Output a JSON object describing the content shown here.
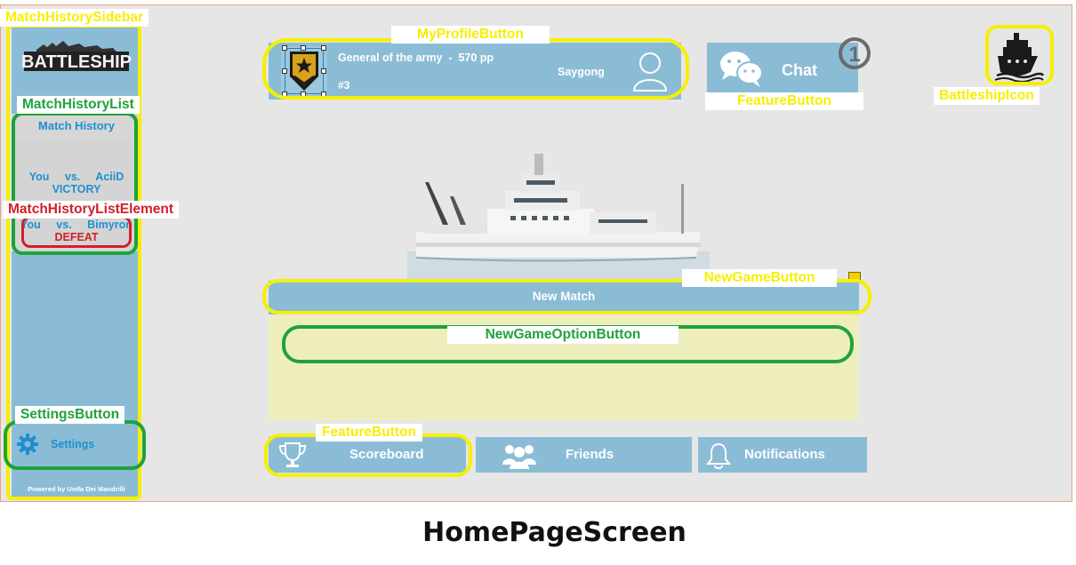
{
  "caption": "HomePageScreen",
  "sidebar": {
    "logo_text": "BATTLESHIP",
    "match_history_title": "Match History",
    "matches": [
      {
        "vs_text": "You vs. AciiD",
        "result": "VICTORY",
        "outcome": "victory"
      },
      {
        "vs_text": "You vs. Bimyron",
        "result": "DEFEAT",
        "outcome": "defeat"
      }
    ],
    "settings_label": "Settings",
    "powered_by": "Powered by Unifa Dei Mandrilli"
  },
  "profile": {
    "rank_line": "General of the army  -  570 pp",
    "rank_number": "#3",
    "username": "Saygong"
  },
  "chat": {
    "label": "Chat",
    "badge_count": "1"
  },
  "new_match_label": "New Match",
  "bottom_buttons": {
    "scoreboard": "Scoreboard",
    "friends": "Friends",
    "notifications": "Notifications"
  },
  "annotations": {
    "match_history_sidebar": "MatchHistorySidebar",
    "match_history_list": "MatchHistoryList",
    "match_history_list_element": "MatchHistoryListElement",
    "settings_button": "SettingsButton",
    "my_profile_button": "MyProfileButton",
    "feature_button_chat": "FeatureButton",
    "battleship_icon": "BattleshipIcon",
    "new_game_button": "NewGameButton",
    "new_game_option_button": "NewGameOptionButton",
    "feature_button_scoreboard": "FeatureButton"
  },
  "colors": {
    "panel_blue": "#8bbcd6",
    "accent_text_blue": "#1f8fcf",
    "defeat_red": "#d0202a",
    "annotation_yellow": "#f5ef00",
    "annotation_green": "#1fa23a",
    "options_yellow": "#eeeebd"
  },
  "icons": [
    "battleship-logo",
    "rank-chevron-icon",
    "user-avatar-icon",
    "chat-bubbles-icon",
    "notification-badge-icon",
    "ship-icon",
    "gear-icon",
    "trophy-icon",
    "friends-icon",
    "bell-icon"
  ]
}
